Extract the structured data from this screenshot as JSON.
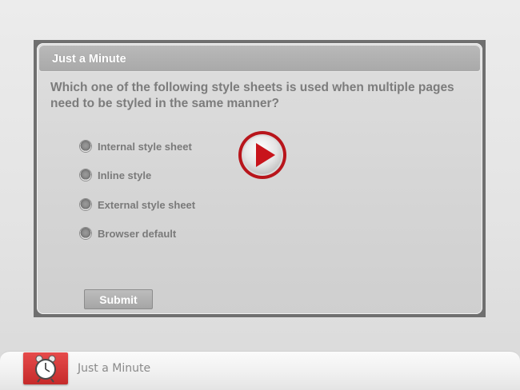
{
  "quiz": {
    "title": "Just a Minute",
    "question": "Which one of the following style sheets is used when multiple pages need to be styled in the same manner?",
    "options": [
      {
        "label": "Internal style sheet"
      },
      {
        "label": "Inline style"
      },
      {
        "label": "External style sheet"
      },
      {
        "label": "Browser default"
      }
    ],
    "submit_label": "Submit"
  },
  "footer": {
    "label": "Just a Minute",
    "icon": "alarm-clock-icon"
  },
  "overlay": {
    "icon": "play-icon"
  },
  "colors": {
    "play_accent": "#b8151b",
    "footer_icon_bg": "#d63a3a"
  }
}
